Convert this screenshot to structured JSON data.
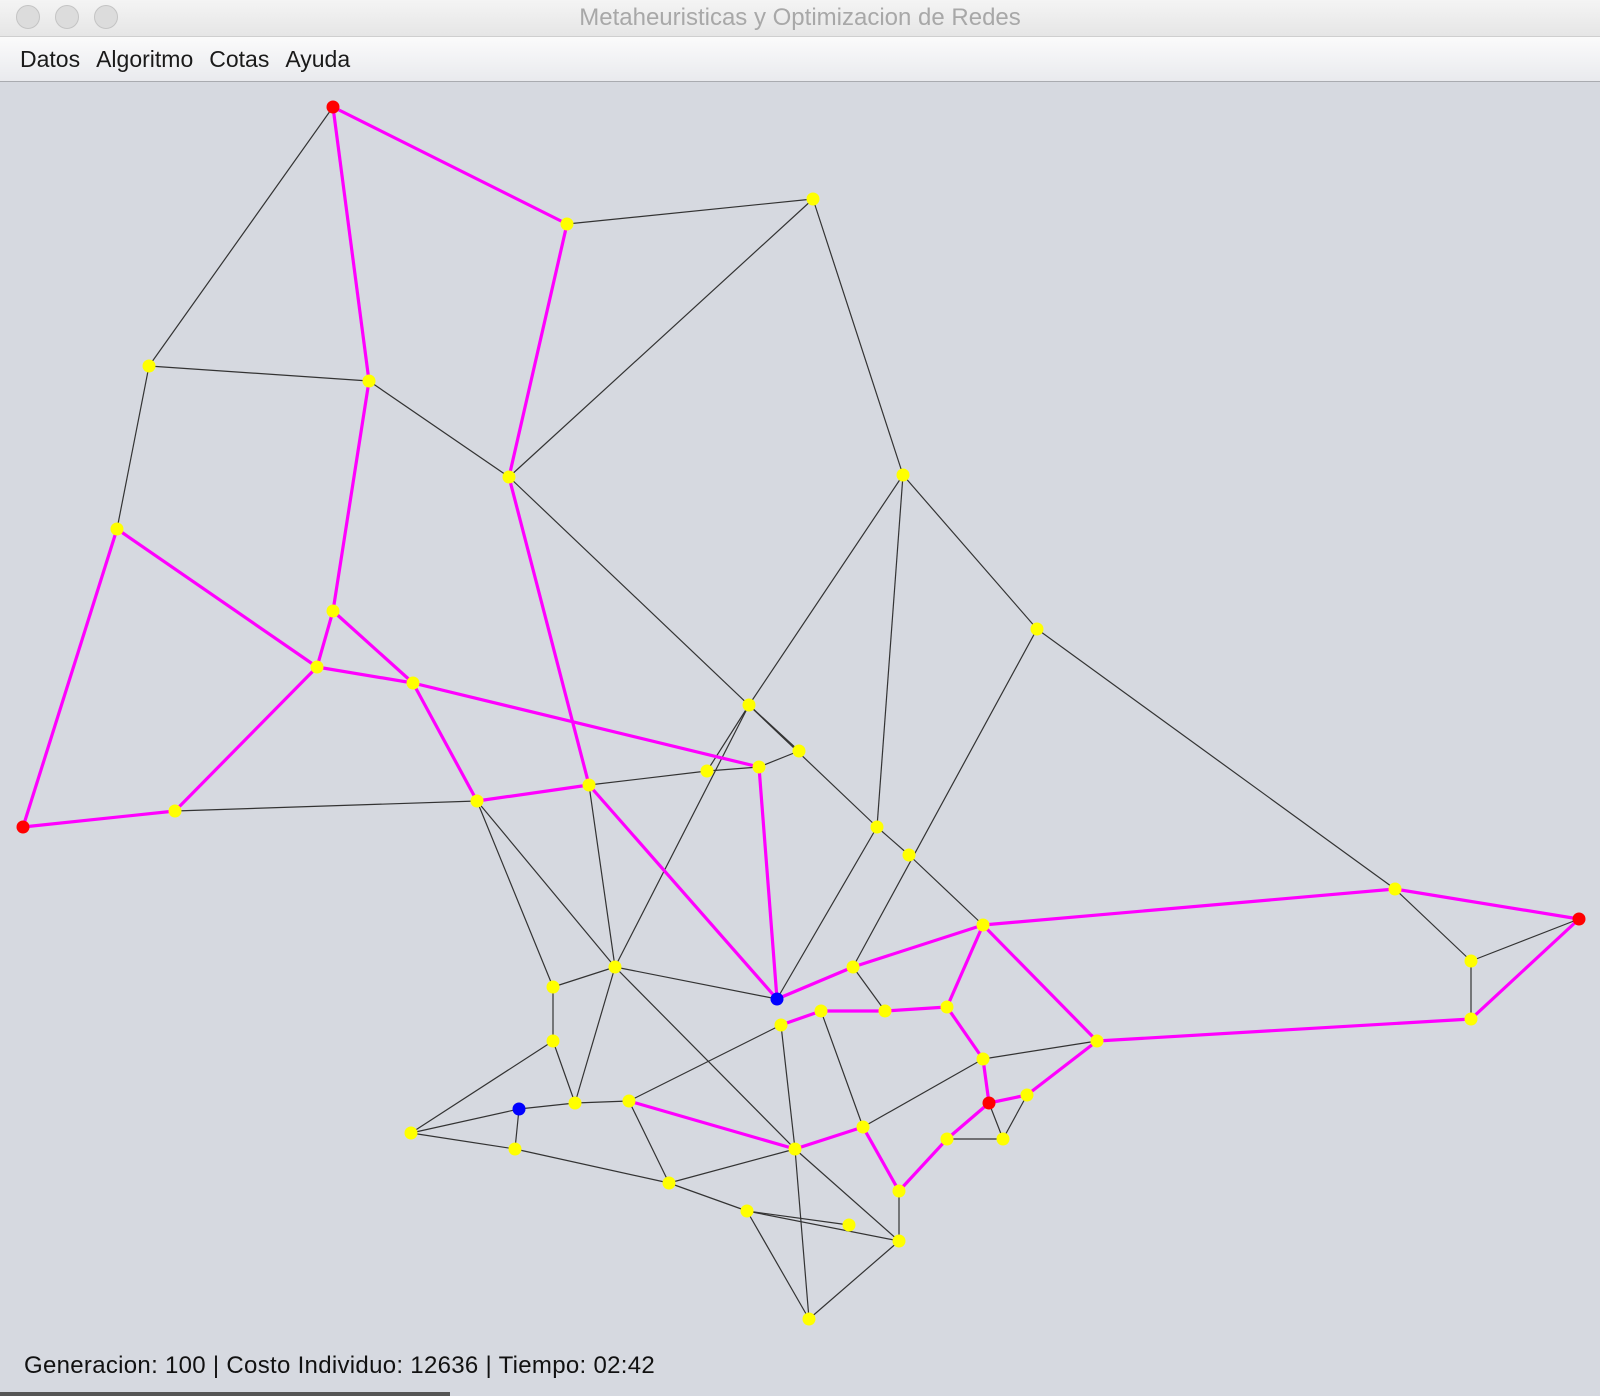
{
  "window": {
    "title": "Metaheuristicas y Optimizacion de Redes"
  },
  "menu": {
    "items": [
      "Datos",
      "Algoritmo",
      "Cotas",
      "Ayuda"
    ]
  },
  "status": {
    "text": "Generacion: 100 | Costo Individuo: 12636 | Tiempo: 02:42"
  },
  "colors": {
    "background": "#d6d9e0",
    "edge": "#333333",
    "path_edge": "#ff00ff",
    "node_default": "#ffff00",
    "node_terminal": "#ff0000",
    "node_special": "#0000ff"
  }
}
